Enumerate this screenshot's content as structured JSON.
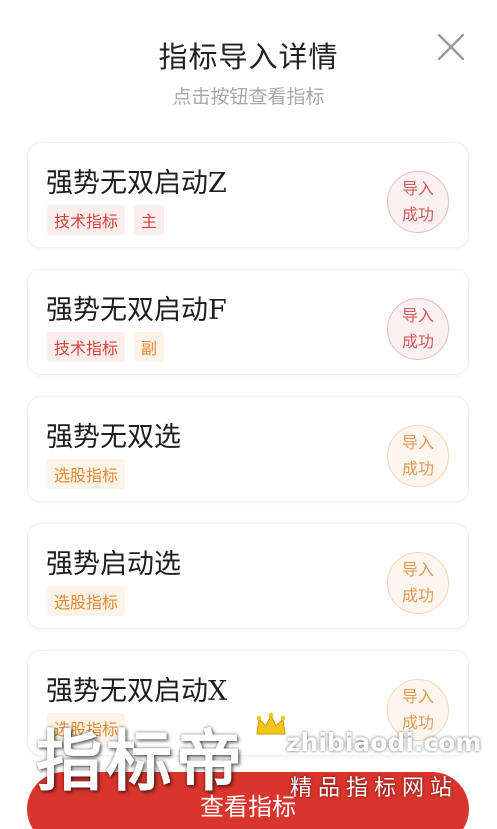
{
  "dialog": {
    "title": "指标导入详情",
    "subtitle": "点击按钮查看指标",
    "close_icon": "close-icon"
  },
  "items": [
    {
      "name": "强势无双启动Z",
      "tags": [
        {
          "label": "技术指标",
          "tone": "red"
        },
        {
          "label": "主",
          "tone": "red"
        }
      ],
      "status_line1": "导入",
      "status_line2": "成功",
      "status_tone": "red"
    },
    {
      "name": "强势无双启动F",
      "tags": [
        {
          "label": "技术指标",
          "tone": "red"
        },
        {
          "label": "副",
          "tone": "orange"
        }
      ],
      "status_line1": "导入",
      "status_line2": "成功",
      "status_tone": "red"
    },
    {
      "name": "强势无双选",
      "tags": [
        {
          "label": "选股指标",
          "tone": "orange"
        }
      ],
      "status_line1": "导入",
      "status_line2": "成功",
      "status_tone": "orange"
    },
    {
      "name": "强势启动选",
      "tags": [
        {
          "label": "选股指标",
          "tone": "orange"
        }
      ],
      "status_line1": "导入",
      "status_line2": "成功",
      "status_tone": "orange"
    },
    {
      "name": "强势无双启动X",
      "tags": [
        {
          "label": "选股指标",
          "tone": "orange"
        }
      ],
      "status_line1": "导入",
      "status_line2": "成功",
      "status_tone": "orange"
    }
  ],
  "footer": {
    "view_button_label": "查看指标"
  },
  "watermark": {
    "brand": "指标帝",
    "domain": "zhibiaodi.com",
    "slogan": "精品指标网站",
    "crown_icon": "crown-icon"
  },
  "colors": {
    "accent_red": "#d9352c",
    "tag_red": "#d9443b",
    "tag_orange": "#e38a33",
    "crown_gold": "#f5c518"
  }
}
